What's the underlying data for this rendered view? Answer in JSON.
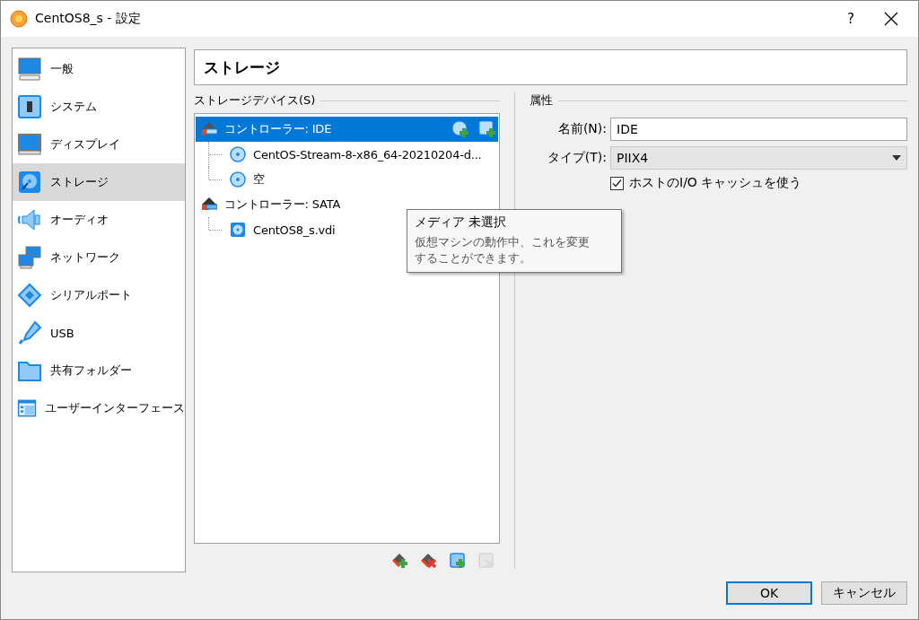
{
  "window": {
    "title": "CentOS8_s - 設定",
    "help": "?"
  },
  "sidebar": {
    "items": [
      {
        "label": "一般",
        "kind": "general",
        "selected": false
      },
      {
        "label": "システム",
        "kind": "system",
        "selected": false
      },
      {
        "label": "ディスプレイ",
        "kind": "display",
        "selected": false
      },
      {
        "label": "ストレージ",
        "kind": "storage",
        "selected": true
      },
      {
        "label": "オーディオ",
        "kind": "audio",
        "selected": false
      },
      {
        "label": "ネットワーク",
        "kind": "network",
        "selected": false
      },
      {
        "label": "シリアルポート",
        "kind": "serial",
        "selected": false
      },
      {
        "label": "USB",
        "kind": "usb",
        "selected": false
      },
      {
        "label": "共有フォルダー",
        "kind": "folder",
        "selected": false
      },
      {
        "label": "ユーザーインターフェース",
        "kind": "ui",
        "selected": false
      }
    ]
  },
  "page_title": "ストレージ",
  "storage_devices": {
    "label": "ストレージデバイス(S)",
    "controllers": [
      {
        "label": "コントローラー: IDE",
        "kind": "ide",
        "selected": true,
        "children": [
          {
            "label": "CentOS-Stream-8-x86_64-20210204-d...",
            "kind": "optical"
          },
          {
            "label": "空",
            "kind": "optical"
          }
        ]
      },
      {
        "label": "コントローラー: SATA",
        "kind": "sata",
        "selected": false,
        "children": [
          {
            "label": "CentOS8_s.vdi",
            "kind": "disk"
          }
        ]
      }
    ],
    "toolbar": [
      {
        "kind": "add-controller",
        "disabled": false
      },
      {
        "kind": "remove-controller",
        "disabled": false
      },
      {
        "kind": "add-attachment",
        "disabled": false
      },
      {
        "kind": "remove-attachment",
        "disabled": true
      }
    ]
  },
  "tooltip": {
    "title": "メディア 未選択",
    "text": "仮想マシンの動作中、これを変更することができます。"
  },
  "attributes": {
    "label": "属性",
    "name_label": "名前(N):",
    "name_value": "IDE",
    "type_label": "タイプ(T):",
    "type_value": "PIIX4",
    "host_cache": {
      "label": "ホストのI/O キャッシュを使う",
      "checked": true
    }
  },
  "buttons": [
    {
      "label": "OK",
      "default": true
    },
    {
      "label": "キャンセル",
      "default": false
    }
  ]
}
